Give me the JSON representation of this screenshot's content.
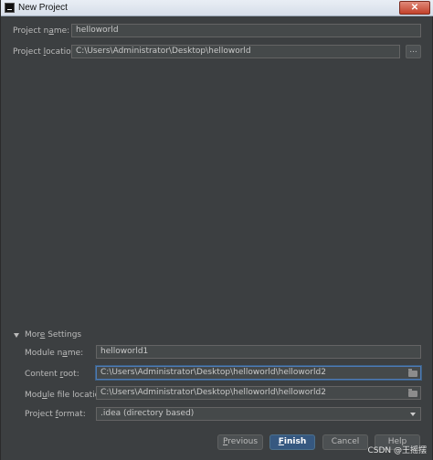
{
  "window": {
    "title": "New Project",
    "close_glyph": "✕"
  },
  "project": {
    "name_label_pre": "Project n",
    "name_label_ul": "a",
    "name_label_post": "me:",
    "name_value": "helloworld",
    "location_label_pre": "Project ",
    "location_label_ul": "l",
    "location_label_post": "ocation:",
    "location_value": "C:\\Users\\Administrator\\Desktop\\helloworld",
    "browse_label": "..."
  },
  "more_settings": {
    "title_pre": "Mor",
    "title_ul": "e",
    "title_post": " Settings",
    "module_name_label_pre": "Module n",
    "module_name_label_ul": "a",
    "module_name_label_post": "me:",
    "module_name_value": "helloworld1",
    "content_root_label_pre": "Content ",
    "content_root_label_ul": "r",
    "content_root_label_post": "oot:",
    "content_root_value": "C:\\Users\\Administrator\\Desktop\\helloworld\\helloworld2",
    "module_file_label_pre": "Mod",
    "module_file_label_ul": "u",
    "module_file_label_post": "le file location:",
    "module_file_value": "C:\\Users\\Administrator\\Desktop\\helloworld\\helloworld2",
    "format_label_pre": "Project ",
    "format_label_ul": "f",
    "format_label_post": "ormat:",
    "format_value": ".idea (directory based)"
  },
  "buttons": {
    "previous_pre": "",
    "previous_ul": "P",
    "previous_post": "revious",
    "finish_pre": "",
    "finish_ul": "F",
    "finish_post": "inish",
    "cancel": "Cancel",
    "help": "Help"
  },
  "watermark": "CSDN @王摇摆"
}
